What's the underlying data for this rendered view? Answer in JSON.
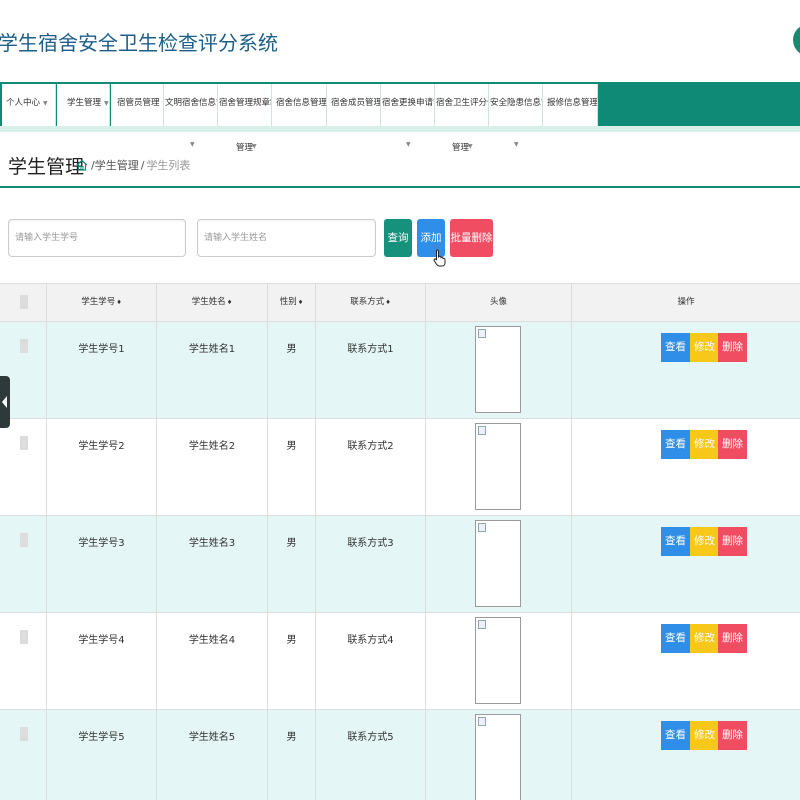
{
  "app": {
    "title": "学生宿舍安全卫生检查评分系统"
  },
  "nav": {
    "items": [
      {
        "label": "个人中心"
      },
      {
        "label": "学生管理"
      },
      {
        "label": "宿管员管理"
      },
      {
        "label": "文明宿舍信息管理"
      },
      {
        "label": "宿舍管理规章制度"
      },
      {
        "label": "宿舍信息管理"
      },
      {
        "label": "宿舍成员管理"
      },
      {
        "label": "宿舍更换申请管理"
      },
      {
        "label": "宿舍卫生评分信息"
      },
      {
        "label": "安全隐患信息管理"
      },
      {
        "label": "报修信息管理"
      }
    ],
    "overflow_labels": [
      "管理",
      "管理"
    ]
  },
  "page": {
    "title": "学生管理",
    "breadcrumb": {
      "section": "学生管理",
      "current": "学生列表",
      "separator": "/"
    }
  },
  "search": {
    "student_no_placeholder": "请输入学生学号",
    "student_name_placeholder": "请输入学生姓名",
    "query_label": "查询",
    "add_label": "添加",
    "batch_delete_label": "批量删除"
  },
  "table": {
    "headers": {
      "student_no": "学生学号",
      "student_name": "学生姓名",
      "gender": "性别",
      "contact": "联系方式",
      "avatar": "头像",
      "actions": "操作"
    },
    "rows": [
      {
        "student_no": "学生学号1",
        "student_name": "学生姓名1",
        "gender": "男",
        "contact": "联系方式1"
      },
      {
        "student_no": "学生学号2",
        "student_name": "学生姓名2",
        "gender": "男",
        "contact": "联系方式2"
      },
      {
        "student_no": "学生学号3",
        "student_name": "学生姓名3",
        "gender": "男",
        "contact": "联系方式3"
      },
      {
        "student_no": "学生学号4",
        "student_name": "学生姓名4",
        "gender": "男",
        "contact": "联系方式4"
      },
      {
        "student_no": "学生学号5",
        "student_name": "学生姓名5",
        "gender": "男",
        "contact": "联系方式5"
      }
    ],
    "actions": {
      "view_label": "查看",
      "edit_label": "修改",
      "delete_label": "删除"
    }
  },
  "colors": {
    "primary": "#0f8a76",
    "title_text": "#1d5f8a",
    "view": "#2f8ee8",
    "edit": "#f7c71a",
    "delete": "#f04d63",
    "row_alt": "#e4f6f5"
  },
  "icons": [
    "home-icon",
    "user-icon",
    "pointer-cursor-icon",
    "sort-icon",
    "caret-down-icon",
    "collapse-sidebar-icon"
  ]
}
